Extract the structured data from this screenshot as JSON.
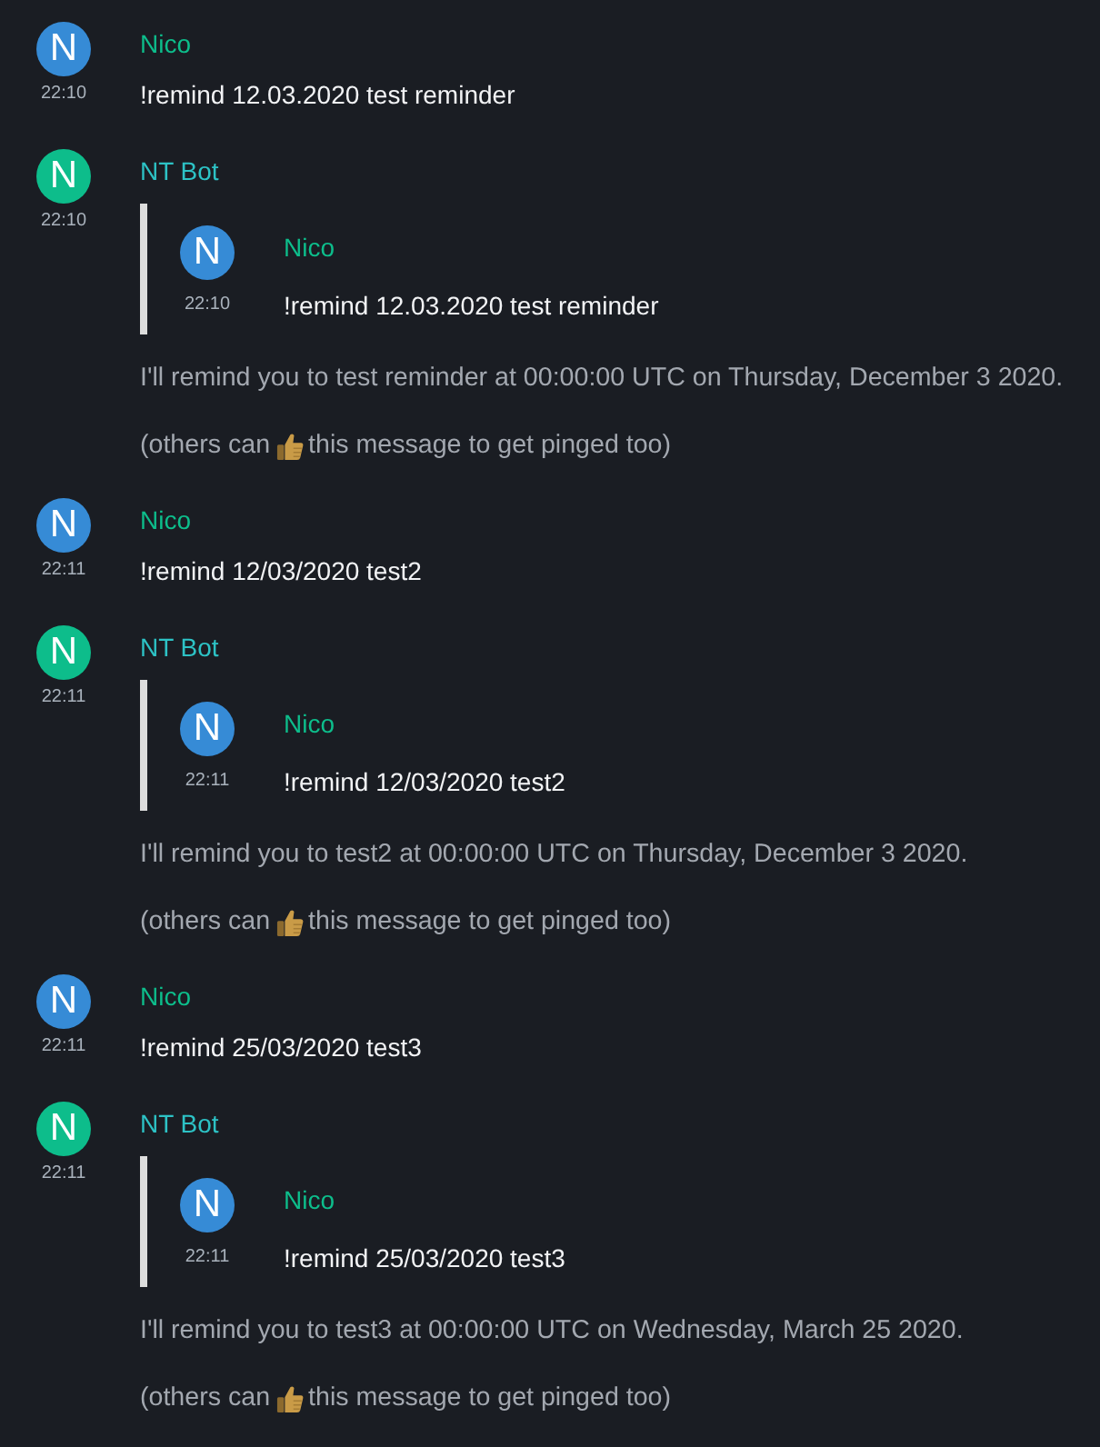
{
  "messages": [
    {
      "kind": "user",
      "sender": {
        "name": "Nico",
        "color": "#0dbd8b"
      },
      "avatar": {
        "letter": "N",
        "color": "#368bd6"
      },
      "time": "22:10",
      "body": "!remind 12.03.2020 test reminder"
    },
    {
      "kind": "bot",
      "sender": {
        "name": "NT Bot",
        "color": "#2dc2c5"
      },
      "avatar": {
        "letter": "N",
        "color": "#0dbd8b"
      },
      "time": "22:10",
      "quote": {
        "sender": {
          "name": "Nico",
          "color": "#0dbd8b"
        },
        "avatar": {
          "letter": "N",
          "color": "#368bd6"
        },
        "time": "22:10",
        "body": "!remind 12.03.2020 test reminder"
      },
      "notices": [
        {
          "kind": "text",
          "text": "I'll remind you to test reminder at 00:00:00 UTC on Thursday, December 3 2020."
        },
        {
          "kind": "reaction_hint",
          "before": "(others can",
          "after": "this message to get pinged too)"
        }
      ]
    },
    {
      "kind": "user",
      "sender": {
        "name": "Nico",
        "color": "#0dbd8b"
      },
      "avatar": {
        "letter": "N",
        "color": "#368bd6"
      },
      "time": "22:11",
      "body": "!remind 12/03/2020 test2"
    },
    {
      "kind": "bot",
      "sender": {
        "name": "NT Bot",
        "color": "#2dc2c5"
      },
      "avatar": {
        "letter": "N",
        "color": "#0dbd8b"
      },
      "time": "22:11",
      "quote": {
        "sender": {
          "name": "Nico",
          "color": "#0dbd8b"
        },
        "avatar": {
          "letter": "N",
          "color": "#368bd6"
        },
        "time": "22:11",
        "body": "!remind 12/03/2020 test2"
      },
      "notices": [
        {
          "kind": "text",
          "text": "I'll remind you to test2 at 00:00:00 UTC on Thursday, December 3 2020."
        },
        {
          "kind": "reaction_hint",
          "before": "(others can",
          "after": "this message to get pinged too)"
        }
      ]
    },
    {
      "kind": "user",
      "sender": {
        "name": "Nico",
        "color": "#0dbd8b"
      },
      "avatar": {
        "letter": "N",
        "color": "#368bd6"
      },
      "time": "22:11",
      "body": "!remind 25/03/2020 test3"
    },
    {
      "kind": "bot",
      "sender": {
        "name": "NT Bot",
        "color": "#2dc2c5"
      },
      "avatar": {
        "letter": "N",
        "color": "#0dbd8b"
      },
      "time": "22:11",
      "quote": {
        "sender": {
          "name": "Nico",
          "color": "#0dbd8b"
        },
        "avatar": {
          "letter": "N",
          "color": "#368bd6"
        },
        "time": "22:11",
        "body": "!remind 25/03/2020 test3"
      },
      "notices": [
        {
          "kind": "text",
          "text": "I'll remind you to test3 at 00:00:00 UTC on Wednesday, March 25 2020."
        },
        {
          "kind": "reaction_hint",
          "before": "(others can",
          "after": "this message to get pinged too)"
        }
      ]
    }
  ]
}
